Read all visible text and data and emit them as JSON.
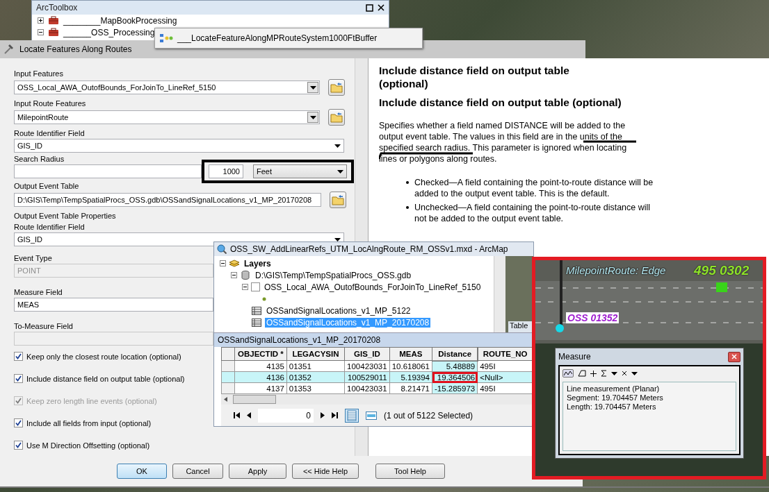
{
  "toolbox": {
    "title": "ArcToolbox",
    "items": [
      {
        "label": "________MapBookProcessing",
        "expanded": false
      },
      {
        "label": "______OSS_Processing",
        "expanded": true
      }
    ]
  },
  "tool_tab": {
    "label": "___LocateFeatureAlongMPRouteSystem1000FtBuffer"
  },
  "dialog": {
    "title": "Locate Features Along Routes",
    "params": [
      {
        "kind": "combo",
        "label": "Input Features",
        "value": "OSS_Local_AWA_OutofBounds_ForJoinTo_LineRef_5150"
      },
      {
        "kind": "combo",
        "label": "Input Route Features",
        "value": "MilepointRoute"
      },
      {
        "kind": "select",
        "label": "Route Identifier Field",
        "value": "GIS_ID"
      },
      {
        "kind": "radius",
        "label": "Search Radius",
        "value": "1000",
        "unit": "Feet"
      },
      {
        "kind": "path",
        "label": "Output Event Table",
        "value": "D:\\GIS\\Temp\\TempSpatialProcs_OSS.gdb\\OSSandSignalLocations_v1_MP_20170208"
      },
      {
        "kind": "section",
        "label": "Output Event Table Properties"
      },
      {
        "kind": "select",
        "label": "Route Identifier Field",
        "value": "GIS_ID"
      },
      {
        "kind": "text",
        "label": "Event Type",
        "value": "POINT",
        "disabled": true
      },
      {
        "kind": "text",
        "label": "Measure Field",
        "value": "MEAS",
        "disabled": false
      },
      {
        "kind": "text",
        "label": "To-Measure Field",
        "disabled": true
      }
    ],
    "checkboxes": [
      {
        "label": "Keep only the closest route location (optional)",
        "checked": true,
        "disabled": false
      },
      {
        "label": "Include distance field on output table (optional)",
        "checked": true,
        "disabled": false
      },
      {
        "label": "Keep zero length line events (optional)",
        "checked": true,
        "disabled": true
      },
      {
        "label": "Include all fields from input (optional)",
        "checked": true,
        "disabled": false
      },
      {
        "label": "Use M Direction Offsetting (optional)",
        "checked": true,
        "disabled": false
      }
    ],
    "buttons": [
      {
        "label": "OK",
        "default": true
      },
      {
        "label": "Cancel",
        "default": false
      },
      {
        "label": "Apply",
        "default": false
      },
      {
        "label": "<< Hide Help",
        "default": false
      },
      {
        "label": "Tool Help",
        "default": false
      }
    ]
  },
  "help": {
    "heading": "Include distance field on output table (optional)",
    "subheading": "Include distance field on output table (optional)",
    "paragraph": "Specifies whether a field named DISTANCE will be added to the output event table. The values in this field are in the units of the specified search radius. This parameter is ignored when locating lines or polygons along routes.",
    "bullets": [
      "Checked—A field containing the point-to-route distance will be added to the output event table. This is the default.",
      "Unchecked—A field containing the point-to-route distance will not be added to the output event table."
    ]
  },
  "arcmap": {
    "title": "OSS_SW_AddLinearRefs_UTM_LocAlngRoute_RM_OSSv1.mxd - ArcMap",
    "toc": [
      {
        "kind": "layers",
        "label": "Layers",
        "expanded": true,
        "selected": false,
        "children": [
          {
            "kind": "database",
            "label": "D:\\GIS\\Temp\\TempSpatialProcs_OSS.gdb",
            "expanded": true,
            "selected": false,
            "children": [
              {
                "kind": "layer",
                "label": "OSS_Local_AWA_OutofBounds_ForJoinTo_LineRef_5150",
                "expanded": true,
                "checked": false,
                "selected": false,
                "children": [
                  {
                    "kind": "symbol"
                  }
                ]
              },
              {
                "kind": "table",
                "label": "OSSandSignalLocations_v1_MP_5122",
                "selected": false
              },
              {
                "kind": "table",
                "label": "OSSandSignalLocations_v1_MP_20170208",
                "selected": true
              }
            ]
          }
        ]
      }
    ],
    "side_tab": "Table",
    "table": {
      "title": "OSSandSignalLocations_v1_MP_20170208",
      "columns": [
        {
          "label": "OBJECTID *",
          "selected": false
        },
        {
          "label": "LEGACYSIN",
          "selected": false
        },
        {
          "label": "GIS_ID",
          "selected": false
        },
        {
          "label": "MEAS",
          "selected": false
        },
        {
          "label": "Distance",
          "selected": true
        },
        {
          "label": "ROUTE_NO",
          "selected": false
        }
      ],
      "rows": [
        {
          "selected": false,
          "cells": [
            "4135",
            "01351",
            "100423031",
            "10.618061",
            "5.48889",
            "495I"
          ]
        },
        {
          "selected": true,
          "cells": [
            "4136",
            "01352",
            "100529011",
            "5.19394",
            "19.364506",
            "<Null>"
          ]
        },
        {
          "selected": false,
          "cells": [
            "4137",
            "01353",
            "100423031",
            "8.21471",
            "-15.285973",
            "495I"
          ]
        }
      ],
      "record": "0",
      "status": "(1 out of 5122 Selected)"
    }
  },
  "map": {
    "labels": [
      {
        "kind": "route",
        "text": "MilepointRoute: Edge"
      },
      {
        "kind": "milepost",
        "text": "495 0302"
      },
      {
        "kind": "point",
        "text": "OSS 01352"
      }
    ],
    "measure": {
      "title": "Measure",
      "lines": [
        "Line measurement (Planar)",
        "Segment: 19.704457 Meters",
        "Length: 19.704457 Meters"
      ]
    }
  }
}
